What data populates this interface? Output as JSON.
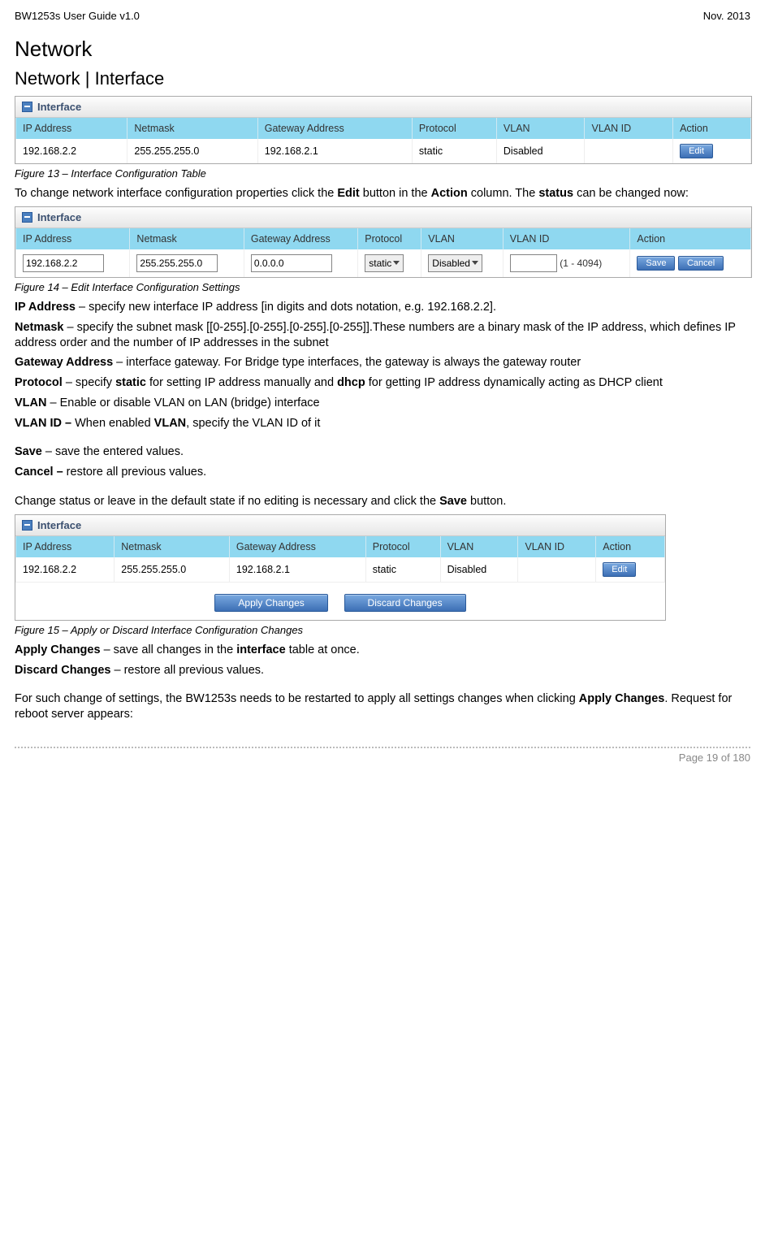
{
  "header": {
    "left": "BW1253s User Guide v1.0",
    "right": "Nov.  2013"
  },
  "titles": {
    "h1": "Network",
    "h2": "Network | Interface"
  },
  "fig13": {
    "caption": "Figure 13  – Interface Configuration Table",
    "panel_label": "Interface",
    "columns": [
      "IP Address",
      "Netmask",
      "Gateway Address",
      "Protocol",
      "VLAN",
      "VLAN ID",
      "Action"
    ],
    "row": {
      "ip": "192.168.2.2",
      "mask": "255.255.255.0",
      "gw": "192.168.2.1",
      "proto": "static",
      "vlan": "Disabled",
      "vlanid": "",
      "action_label": "Edit"
    }
  },
  "para1a": "To change network interface configuration properties click the ",
  "para1b": " button in the ",
  "para1c": " column. The ",
  "para1d": " can be changed now:",
  "bold_edit": "Edit",
  "bold_action": "Action",
  "bold_status": "status",
  "fig14": {
    "caption": "Figure 14 – Edit Interface Configuration Settings",
    "panel_label": "Interface",
    "columns": [
      "IP Address",
      "Netmask",
      "Gateway Address",
      "Protocol",
      "VLAN",
      "VLAN ID",
      "Action"
    ],
    "row": {
      "ip": "192.168.2.2",
      "mask": "255.255.255.0",
      "gw": "0.0.0.0",
      "proto": "static",
      "vlan": "Disabled",
      "vlanid": "",
      "range": "(1 - 4094)",
      "save": "Save",
      "cancel": "Cancel"
    }
  },
  "defs": {
    "ip_l": "IP Address",
    "ip_t": " – specify new interface IP address [in digits and dots notation, e.g. 192.168.2.2].",
    "nm_l": "Netmask",
    "nm_t": " – specify the subnet mask [[0-255].[0-255].[0-255].[0-255]].These numbers are a binary mask of the IP address, which defines IP address order and the number of IP addresses in the subnet",
    "gw_l": "Gateway Address",
    "gw_t": " – interface gateway. For Bridge type interfaces, the gateway is always the gateway router",
    "pr_l": "Protocol",
    "pr_t1": " – specify ",
    "pr_b1": "static",
    "pr_t2": " for setting IP address manually and ",
    "pr_b2": "dhcp",
    "pr_t3": " for getting IP address dynamically acting as DHCP client",
    "vl_l": "VLAN",
    "vl_t": " – Enable or disable VLAN on LAN (bridge) interface",
    "vi_l": "VLAN ID – ",
    "vi_t1": "When enabled ",
    "vi_b": "VLAN",
    "vi_t2": ", specify the VLAN ID of it",
    "sv_l": "Save",
    "sv_t": " – save the entered values.",
    "cn_l": "Cancel – ",
    "cn_t": "restore all previous values."
  },
  "para2a": "Change status or leave in the default state if no editing is necessary and click the ",
  "para2b": " button.",
  "bold_save": "Save",
  "fig15": {
    "caption": "Figure 15 – Apply or Discard Interface Configuration Changes",
    "panel_label": "Interface",
    "columns": [
      "IP Address",
      "Netmask",
      "Gateway Address",
      "Protocol",
      "VLAN",
      "VLAN ID",
      "Action"
    ],
    "row": {
      "ip": "192.168.2.2",
      "mask": "255.255.255.0",
      "gw": "192.168.2.1",
      "proto": "static",
      "vlan": "Disabled",
      "vlanid": "",
      "action_label": "Edit"
    },
    "apply": "Apply Changes",
    "discard": "Discard Changes"
  },
  "tail": {
    "ac_l": "Apply Changes",
    "ac_t1": " – save all changes in the ",
    "ac_b": "interface",
    "ac_t2": " table at once.",
    "dc_l": "Discard Changes",
    "dc_t": " – restore all previous values.",
    "p1": "For such change of settings, the BW1253s needs to be restarted to apply all settings changes when clicking ",
    "p1b": "Apply Changes",
    "p2": ". Request for reboot server appears:"
  },
  "footer": "Page 19 of 180"
}
